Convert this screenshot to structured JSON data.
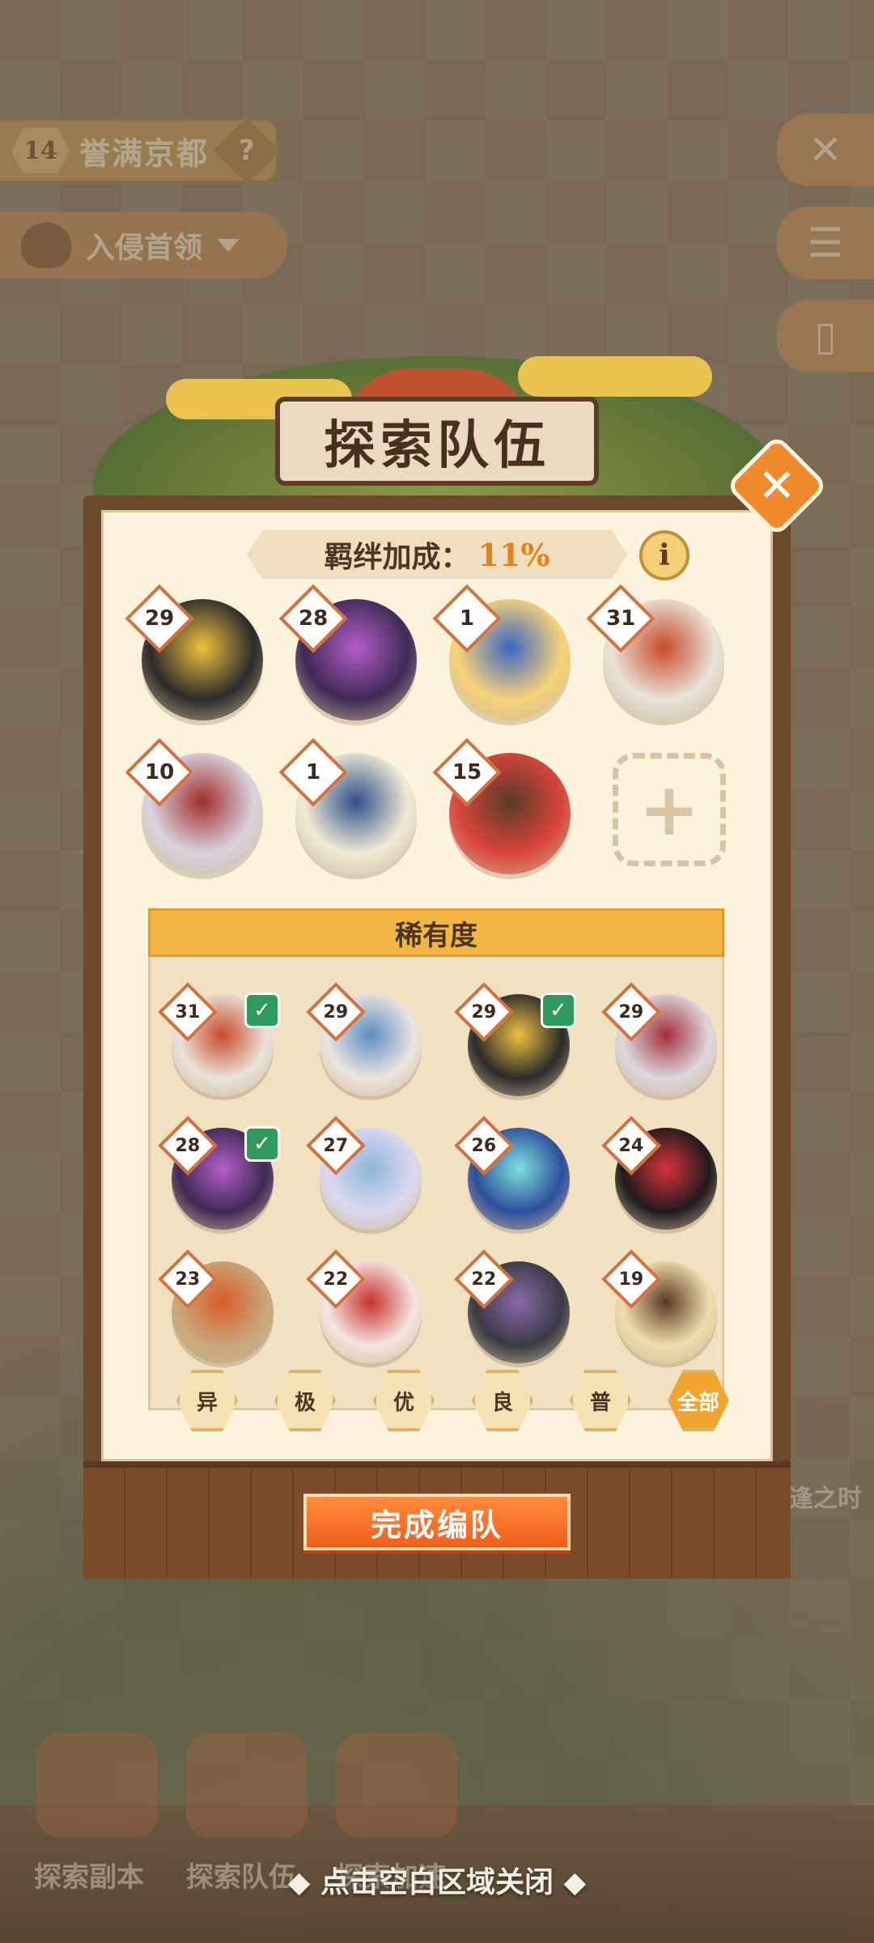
{
  "hud": {
    "level": "14",
    "stage_title": "誉满京都",
    "help_icon": "?",
    "boss_label": "入侵首领",
    "close_icon": "✕",
    "menu_icon": "☰",
    "card_icon": "▯"
  },
  "panel": {
    "title": "探索队伍",
    "close_icon": "✕",
    "bond_label": "羁绊加成：",
    "bond_value": "11%",
    "info_icon": "i"
  },
  "team": [
    {
      "level": "29",
      "color": "#2b2b2b",
      "accent": "#f0c040"
    },
    {
      "level": "28",
      "color": "#3e2a55",
      "accent": "#b55dc9"
    },
    {
      "level": "1",
      "color": "#f5d27a",
      "accent": "#3c66c4"
    },
    {
      "level": "31",
      "color": "#e9e2d8",
      "accent": "#c84a2a"
    },
    {
      "level": "10",
      "color": "#d9d3dd",
      "accent": "#a02c2c"
    },
    {
      "level": "1",
      "color": "#f0ead5",
      "accent": "#2e4e8a"
    },
    {
      "level": "15",
      "color": "#d8453a",
      "accent": "#5a3a2a"
    }
  ],
  "add_slot_icon": "+",
  "rarity_header": "稀有度",
  "roster": [
    {
      "level": "31",
      "checked": true,
      "color": "#e9e2d8",
      "accent": "#c84a2a"
    },
    {
      "level": "29",
      "checked": false,
      "color": "#ece4e0",
      "accent": "#5b8ec4"
    },
    {
      "level": "29",
      "checked": true,
      "color": "#2b2b2b",
      "accent": "#f0c040"
    },
    {
      "level": "29",
      "checked": false,
      "color": "#ddd6dc",
      "accent": "#a0303a"
    },
    {
      "level": "28",
      "checked": true,
      "color": "#3e2a55",
      "accent": "#b55dc9"
    },
    {
      "level": "27",
      "checked": false,
      "color": "#ddd8f0",
      "accent": "#8db6d9"
    },
    {
      "level": "26",
      "checked": false,
      "color": "#2e4f9a",
      "accent": "#7fe0e0"
    },
    {
      "level": "24",
      "checked": false,
      "color": "#1f1b1f",
      "accent": "#d7323a"
    },
    {
      "level": "23",
      "checked": false,
      "color": "#c8a67a",
      "accent": "#d95b2a"
    },
    {
      "level": "22",
      "checked": false,
      "color": "#f3e6e0",
      "accent": "#c8302f"
    },
    {
      "level": "22",
      "checked": false,
      "color": "#3a3a45",
      "accent": "#8a6aa8"
    },
    {
      "level": "19",
      "checked": false,
      "color": "#f0dcae",
      "accent": "#5a3a22"
    }
  ],
  "filters": [
    "异",
    "极",
    "优",
    "良",
    "普",
    "全部"
  ],
  "active_filter": "全部",
  "done_button": "完成编队",
  "bottom_tabs": [
    "探索副本",
    "探索队伍",
    "探索加速"
  ],
  "side_label": "逢之时",
  "close_hint": "◆ 点击空白区域关闭 ◆"
}
